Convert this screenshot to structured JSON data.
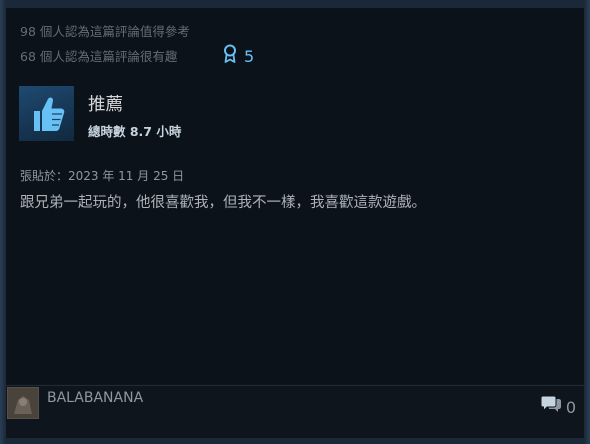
{
  "review": {
    "helpful_text": "98 個人認為這篇評論值得參考",
    "funny_text": "68 個人認為這篇評論很有趣",
    "award_count": "5",
    "verdict": "推薦",
    "hours": "總時數 8.7 小時",
    "posted": "張貼於：2023 年 11 月 25 日",
    "text": "跟兄弟一起玩的，他很喜歡我，但我不一樣，我喜歡這款遊戲。"
  },
  "author": {
    "name": "BALABANANA",
    "comment_count": "0"
  },
  "icons": {
    "thumb": "thumbs-up-icon",
    "award": "award-ribbon-icon",
    "comment": "comment-bubbles-icon"
  },
  "colors": {
    "accent": "#66c0f4",
    "background": "#0c121a"
  }
}
